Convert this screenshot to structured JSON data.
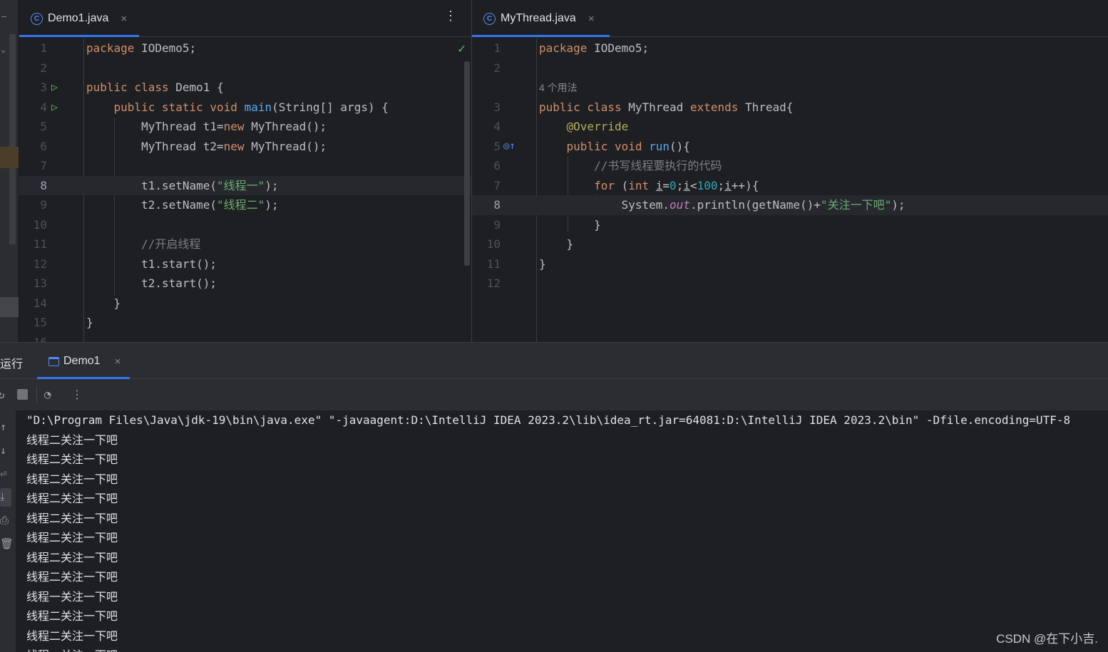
{
  "left_editor": {
    "tab_label": "Demo1.java",
    "tab_close": "×",
    "menu_label": "⋮",
    "lines": [
      {
        "n": "1",
        "tokens": [
          [
            "kw",
            "package "
          ],
          [
            "",
            "IODemo5;"
          ]
        ]
      },
      {
        "n": "2",
        "tokens": []
      },
      {
        "n": "3",
        "run": true,
        "tokens": [
          [
            "kw",
            "public class "
          ],
          [
            "",
            "Demo1 {"
          ]
        ]
      },
      {
        "n": "4",
        "run": true,
        "tokens": [
          [
            "",
            "    "
          ],
          [
            "kw",
            "public static void "
          ],
          [
            "fn",
            "main"
          ],
          [
            "",
            "(String[] args) {"
          ]
        ]
      },
      {
        "n": "5",
        "tokens": [
          [
            "",
            "        MyThread t1="
          ],
          [
            "kw",
            "new "
          ],
          [
            "",
            "MyThread();"
          ]
        ]
      },
      {
        "n": "6",
        "tokens": [
          [
            "",
            "        MyThread t2="
          ],
          [
            "kw",
            "new "
          ],
          [
            "",
            "MyThread();"
          ]
        ]
      },
      {
        "n": "7",
        "tokens": []
      },
      {
        "n": "8",
        "current": true,
        "tokens": [
          [
            "",
            "        t1.setName("
          ],
          [
            "str",
            "\"线程一\""
          ],
          [
            "",
            ");"
          ]
        ]
      },
      {
        "n": "9",
        "tokens": [
          [
            "",
            "        t2.setName("
          ],
          [
            "str",
            "\"线程二\""
          ],
          [
            "",
            ");"
          ]
        ]
      },
      {
        "n": "10",
        "tokens": []
      },
      {
        "n": "11",
        "tokens": [
          [
            "",
            "        "
          ],
          [
            "cmt",
            "//开启线程"
          ]
        ]
      },
      {
        "n": "12",
        "tokens": [
          [
            "",
            "        t1.start();"
          ]
        ]
      },
      {
        "n": "13",
        "tokens": [
          [
            "",
            "        t2.start();"
          ]
        ]
      },
      {
        "n": "14",
        "tokens": [
          [
            "",
            "    }"
          ]
        ]
      },
      {
        "n": "15",
        "tokens": [
          [
            "",
            "}"
          ]
        ]
      },
      {
        "n": "16",
        "tokens": []
      }
    ]
  },
  "right_editor": {
    "tab_label": "MyThread.java",
    "tab_close": "×",
    "usage_hint": "4 个用法",
    "lines": [
      {
        "n": "1",
        "tokens": [
          [
            "kw",
            "package "
          ],
          [
            "",
            "IODemo5;"
          ]
        ]
      },
      {
        "n": "2",
        "tokens": []
      },
      {
        "n": "",
        "hint": true,
        "tokens": []
      },
      {
        "n": "3",
        "tokens": [
          [
            "kw",
            "public class "
          ],
          [
            "",
            "MyThread "
          ],
          [
            "kw",
            "extends "
          ],
          [
            "",
            "Thread{"
          ]
        ]
      },
      {
        "n": "4",
        "tokens": [
          [
            "",
            "    "
          ],
          [
            "ann",
            "@Override"
          ]
        ]
      },
      {
        "n": "5",
        "override": true,
        "tokens": [
          [
            "",
            "    "
          ],
          [
            "kw",
            "public void "
          ],
          [
            "fn",
            "run"
          ],
          [
            "",
            "(){"
          ]
        ]
      },
      {
        "n": "6",
        "tokens": [
          [
            "",
            "        "
          ],
          [
            "cmt",
            "//书写线程要执行的代码"
          ]
        ]
      },
      {
        "n": "7",
        "tokens": [
          [
            "",
            "        "
          ],
          [
            "kw",
            "for "
          ],
          [
            "",
            "("
          ],
          [
            "kw",
            "int "
          ],
          [
            "ul",
            "i"
          ],
          [
            "",
            "="
          ],
          [
            "num",
            "0"
          ],
          [
            "",
            ";"
          ],
          [
            "ul",
            "i"
          ],
          [
            "",
            "<"
          ],
          [
            "num",
            "100"
          ],
          [
            "",
            ";"
          ],
          [
            "ul",
            "i"
          ],
          [
            "",
            "++){"
          ]
        ]
      },
      {
        "n": "8",
        "current": true,
        "tokens": [
          [
            "",
            "            System."
          ],
          [
            "fld",
            "out"
          ],
          [
            "",
            ".println(getName()+"
          ],
          [
            "str",
            "\"关注一下吧\""
          ],
          [
            "",
            ");"
          ]
        ]
      },
      {
        "n": "9",
        "tokens": [
          [
            "",
            "        }"
          ]
        ]
      },
      {
        "n": "10",
        "tokens": [
          [
            "",
            "    }"
          ]
        ]
      },
      {
        "n": "11",
        "tokens": [
          [
            "",
            "}"
          ]
        ]
      },
      {
        "n": "12",
        "tokens": []
      }
    ]
  },
  "run_panel": {
    "title": "运行",
    "tab_label": "Demo1",
    "tab_close": "×",
    "command": "\"D:\\Program Files\\Java\\jdk-19\\bin\\java.exe\" \"-javaagent:D:\\IntelliJ IDEA 2023.2\\lib\\idea_rt.jar=64081:D:\\IntelliJ IDEA 2023.2\\bin\" -Dfile.encoding=UTF-8",
    "output": [
      "线程二关注一下吧",
      "线程二关注一下吧",
      "线程二关注一下吧",
      "线程二关注一下吧",
      "线程二关注一下吧",
      "线程二关注一下吧",
      "线程二关注一下吧",
      "线程二关注一下吧",
      "线程一关注一下吧",
      "线程二关注一下吧",
      "线程二关注一下吧",
      "线程一关注一下吧"
    ]
  },
  "watermark": "CSDN @在下小吉."
}
